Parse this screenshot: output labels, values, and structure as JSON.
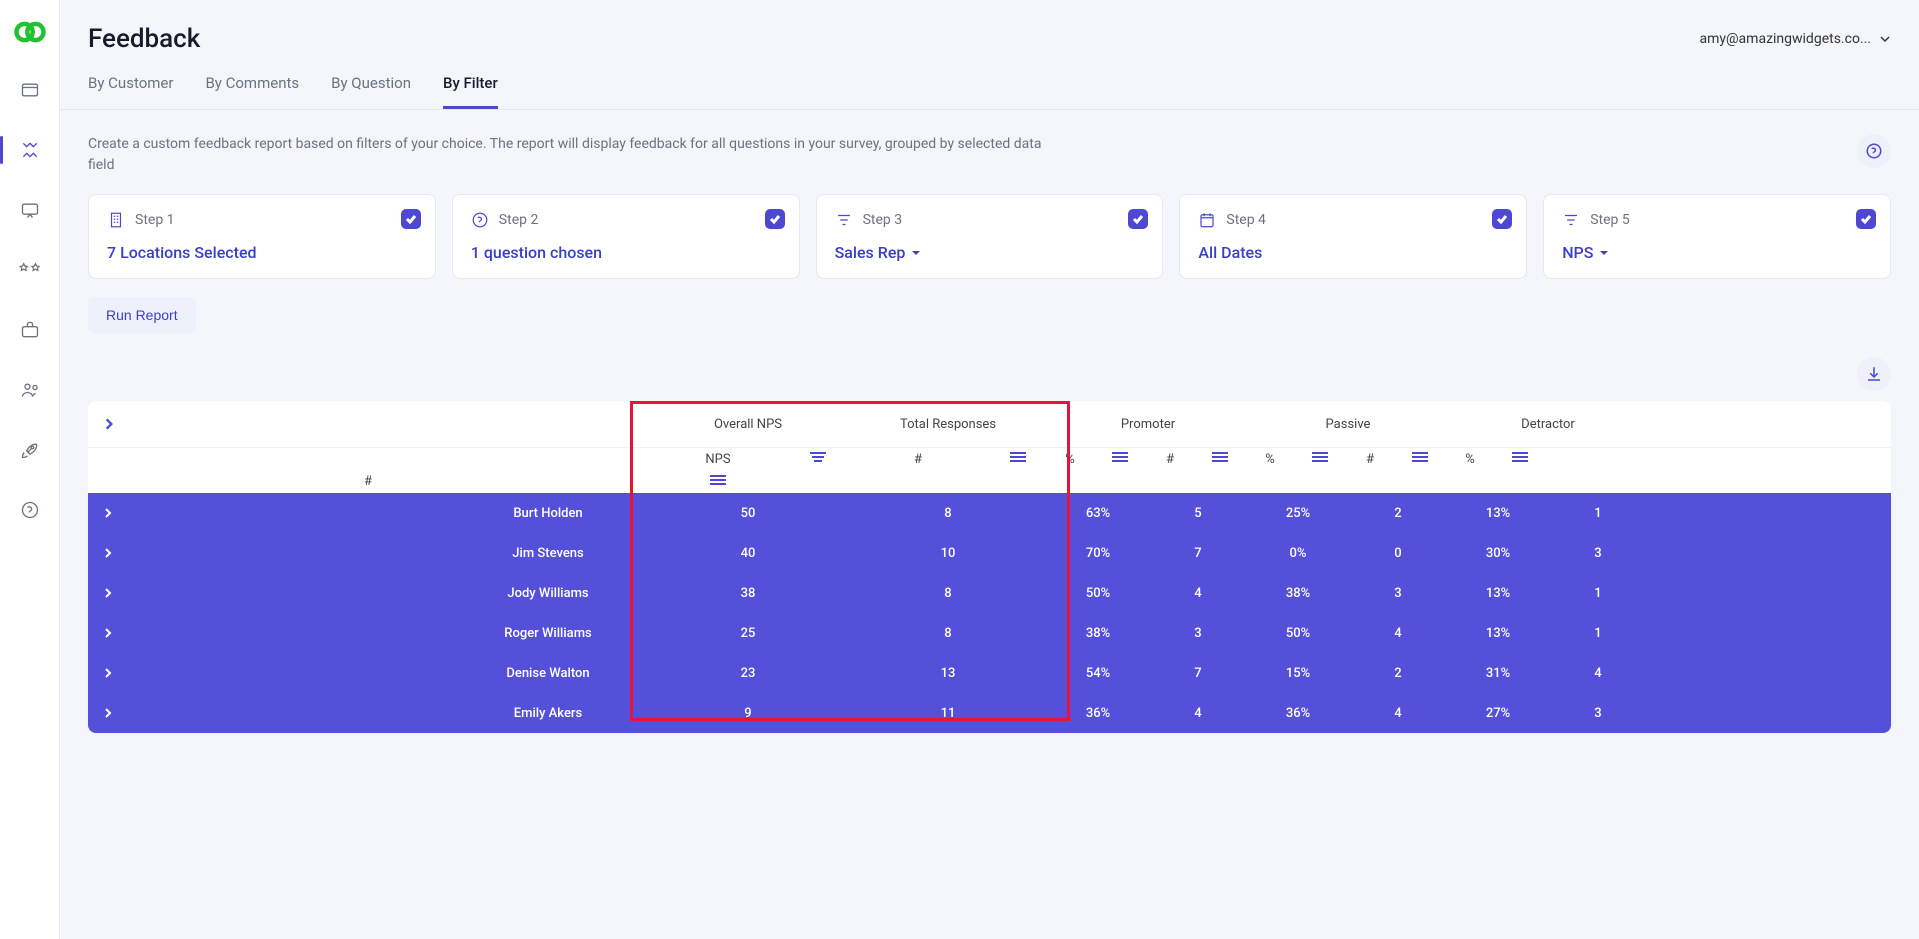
{
  "header": {
    "title": "Feedback",
    "user_email": "amy@amazingwidgets.co..."
  },
  "tabs": [
    {
      "label": "By Customer",
      "active": false
    },
    {
      "label": "By Comments",
      "active": false
    },
    {
      "label": "By Question",
      "active": false
    },
    {
      "label": "By Filter",
      "active": true
    }
  ],
  "description": "Create a custom feedback report based on filters of your choice. The report will display feedback for all questions in your survey, grouped by selected data field",
  "steps": [
    {
      "label": "Step 1",
      "value": "7 Locations Selected",
      "dropdown": false
    },
    {
      "label": "Step 2",
      "value": "1 question chosen",
      "dropdown": false
    },
    {
      "label": "Step 3",
      "value": "Sales Rep",
      "dropdown": true
    },
    {
      "label": "Step 4",
      "value": "All Dates",
      "dropdown": false
    },
    {
      "label": "Step 5",
      "value": "NPS",
      "dropdown": true
    }
  ],
  "run_label": "Run Report",
  "table": {
    "groups": [
      "Overall NPS",
      "Total Responses",
      "Promoter",
      "Passive",
      "Detractor"
    ],
    "sub": [
      "NPS",
      "#",
      "%",
      "#",
      "%",
      "#",
      "%",
      "#"
    ],
    "rows": [
      {
        "name": "Burt Holden",
        "nps": "50",
        "total": "8",
        "pp": "63%",
        "pn": "5",
        "ap": "25%",
        "an": "2",
        "dp": "13%",
        "dn": "1"
      },
      {
        "name": "Jim Stevens",
        "nps": "40",
        "total": "10",
        "pp": "70%",
        "pn": "7",
        "ap": "0%",
        "an": "0",
        "dp": "30%",
        "dn": "3"
      },
      {
        "name": "Jody Williams",
        "nps": "38",
        "total": "8",
        "pp": "50%",
        "pn": "4",
        "ap": "38%",
        "an": "3",
        "dp": "13%",
        "dn": "1"
      },
      {
        "name": "Roger Williams",
        "nps": "25",
        "total": "8",
        "pp": "38%",
        "pn": "3",
        "ap": "50%",
        "an": "4",
        "dp": "13%",
        "dn": "1"
      },
      {
        "name": "Denise Walton",
        "nps": "23",
        "total": "13",
        "pp": "54%",
        "pn": "7",
        "ap": "15%",
        "an": "2",
        "dp": "31%",
        "dn": "4"
      },
      {
        "name": "Emily Akers",
        "nps": "9",
        "total": "11",
        "pp": "36%",
        "pn": "4",
        "ap": "36%",
        "an": "4",
        "dp": "27%",
        "dn": "3"
      }
    ]
  }
}
